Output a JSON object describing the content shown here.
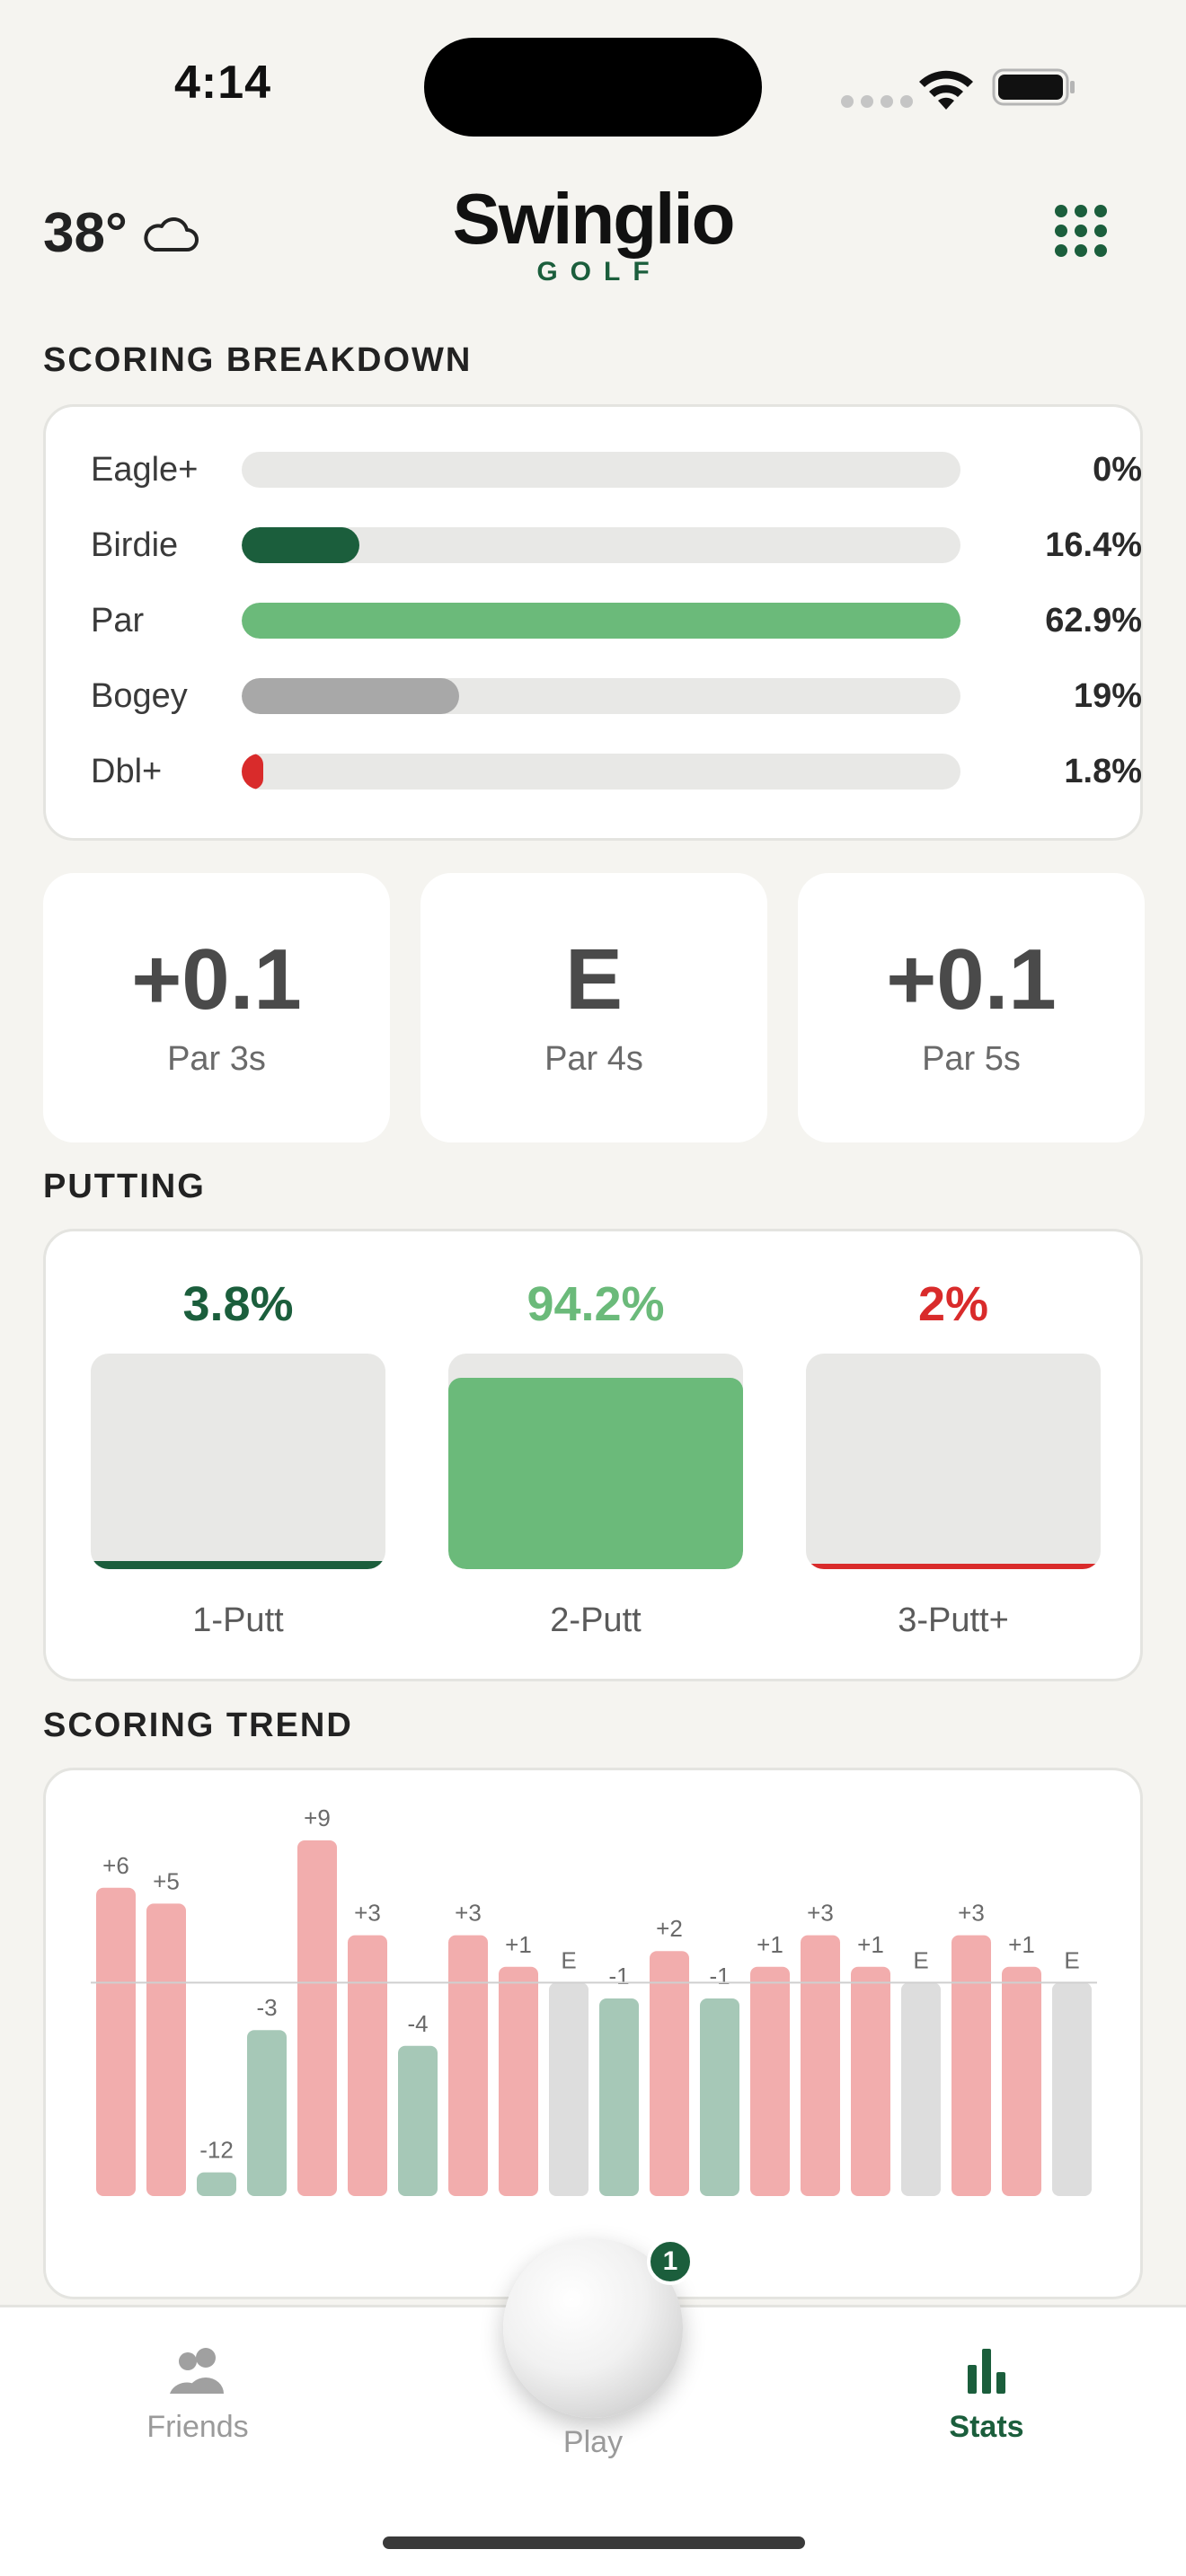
{
  "status_bar": {
    "time": "4:14"
  },
  "header": {
    "temperature": "38°",
    "weather_icon": "cloud-icon",
    "logo_main": "Swinglio",
    "logo_sub": "GOLF",
    "menu_icon": "grid-dots-icon"
  },
  "colors": {
    "brand_green": "#1b5e3c",
    "light_green": "#6bba7a",
    "gray": "#a8a8a8",
    "red": "#d92b2b",
    "trend_over": "#f2adad",
    "trend_under": "#a6c8b7",
    "trend_even": "#dddddd"
  },
  "scoring_breakdown": {
    "title": "SCORING BREAKDOWN",
    "rows": [
      {
        "label": "Eagle+",
        "value": "0%",
        "fraction": 0.0,
        "color": "#1b5e3c"
      },
      {
        "label": "Birdie",
        "value": "16.4%",
        "fraction": 0.164,
        "color": "#1b5e3c"
      },
      {
        "label": "Par",
        "value": "62.9%",
        "fraction": 1.0,
        "color": "#6bba7a"
      },
      {
        "label": "Bogey",
        "value": "19%",
        "fraction": 0.302,
        "color": "#a8a8a8"
      },
      {
        "label": "Dbl+",
        "value": "1.8%",
        "fraction": 0.028,
        "color": "#d92b2b"
      }
    ]
  },
  "par_averages": [
    {
      "value": "+0.1",
      "label": "Par 3s"
    },
    {
      "value": "E",
      "label": "Par 4s"
    },
    {
      "value": "+0.1",
      "label": "Par 5s"
    }
  ],
  "putting": {
    "title": "PUTTING",
    "items": [
      {
        "pct": "3.8%",
        "label": "1-Putt",
        "fraction": 0.038,
        "color": "#1b5e3c"
      },
      {
        "pct": "94.2%",
        "label": "2-Putt",
        "fraction": 0.942,
        "color": "#6bba7a"
      },
      {
        "pct": "2%",
        "label": "3-Putt+",
        "fraction": 0.02,
        "color": "#d92b2b"
      }
    ]
  },
  "scoring_trend": {
    "title": "SCORING TREND"
  },
  "chart_data": {
    "type": "bar",
    "title": "SCORING TREND",
    "labels": [
      "+6",
      "+5",
      "-12",
      "-3",
      "+9",
      "+3",
      "-4",
      "+3",
      "+1",
      "E",
      "-1",
      "+2",
      "-1",
      "+1",
      "+3",
      "+1",
      "E",
      "+3",
      "+1",
      "E"
    ],
    "values": [
      6,
      5,
      -12,
      -3,
      9,
      3,
      -4,
      3,
      1,
      0,
      -1,
      2,
      -1,
      1,
      3,
      1,
      0,
      3,
      1,
      0
    ]
  },
  "tab_bar": {
    "friends_label": "Friends",
    "play_label": "Play",
    "play_badge": "1",
    "stats_label": "Stats"
  }
}
